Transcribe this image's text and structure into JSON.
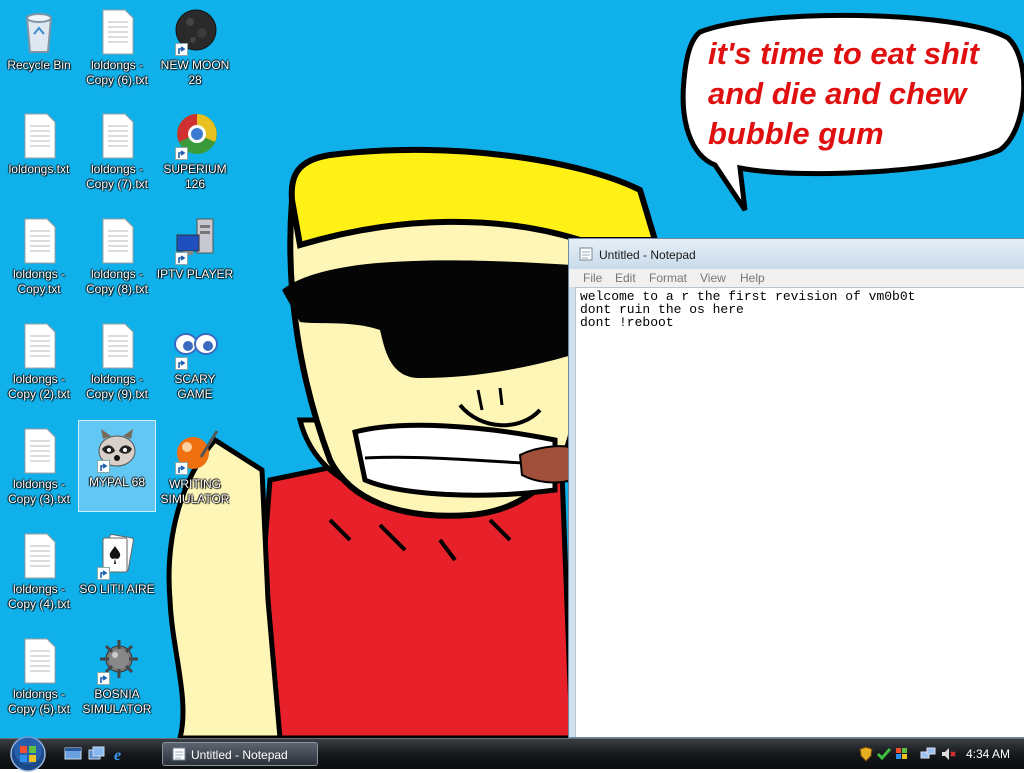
{
  "speech_bubble": {
    "line1": "it's time to eat shit",
    "line2": "and die and chew",
    "line3": "bubble gum"
  },
  "desktop_icons": {
    "recycle_bin": "Recycle Bin",
    "loldongs_copy6": "loldongs -\nCopy (6).txt",
    "new_moon": "NEW MOON\n28",
    "loldongs": "loldongs.txt",
    "loldongs_copy7": "loldongs -\nCopy (7).txt",
    "superium": "SUPERIUM\n126",
    "loldongs_copy": "loldongs -\nCopy.txt",
    "loldongs_copy8": "loldongs -\nCopy (8).txt",
    "iptv_player": "IPTV PLAYER",
    "loldongs_copy2": "loldongs -\nCopy (2).txt",
    "loldongs_copy9": "loldongs -\nCopy (9).txt",
    "scary_game": "SCARY GAME",
    "loldongs_copy3": "loldongs -\nCopy (3).txt",
    "mypal": "MYPAL 68",
    "writing_simulator": "WRITING\nSIMULATOR",
    "loldongs_copy4": "loldongs -\nCopy (4).txt",
    "solitaire": "SO LIT!! AIRE",
    "loldongs_copy5": "loldongs -\nCopy (5).txt",
    "bosnia_simulator": "BOSNIA\nSIMULATOR"
  },
  "notepad": {
    "title": "Untitled - Notepad",
    "menu": [
      "File",
      "Edit",
      "Format",
      "View",
      "Help"
    ],
    "lines": [
      "welcome to a r the first revision of vm0b0t",
      "dont ruin the os here",
      "dont !reboot"
    ]
  },
  "taskbar": {
    "task_label": "Untitled - Notepad",
    "clock": "4:34 AM"
  },
  "colors": {
    "desktop": "#10b0ea",
    "speech_text": "#e01010"
  }
}
